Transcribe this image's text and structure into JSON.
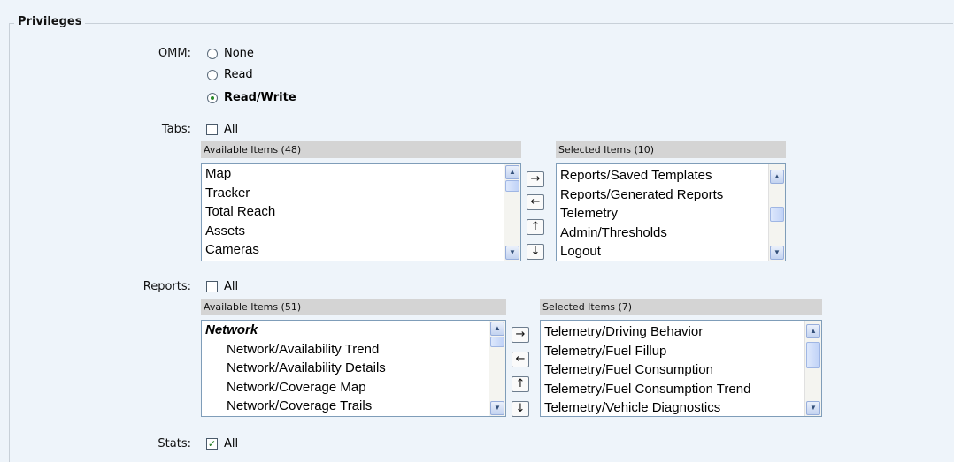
{
  "section": {
    "title": "Privileges"
  },
  "omm": {
    "label": "OMM:",
    "options": [
      {
        "label": "None",
        "selected": false
      },
      {
        "label": "Read",
        "selected": false
      },
      {
        "label": "Read/Write",
        "selected": true
      }
    ]
  },
  "tabs": {
    "label": "Tabs:",
    "all_label": "All",
    "all_checked": false,
    "available_header": "Available Items (48)",
    "selected_header": "Selected Items (10)",
    "available_items": [
      "Map",
      "Tracker",
      "Total Reach",
      "Assets",
      "Cameras"
    ],
    "selected_items": [
      "Reports/Saved Templates",
      "Reports/Generated Reports",
      "Telemetry",
      "Admin/Thresholds",
      "Logout"
    ]
  },
  "reports": {
    "label": "Reports:",
    "all_label": "All",
    "all_checked": false,
    "available_header": "Available Items (51)",
    "selected_header": "Selected Items (7)",
    "available_items": [
      "Network",
      "Network/Availability Trend",
      "Network/Availability Details",
      "Network/Coverage Map",
      "Network/Coverage Trails"
    ],
    "selected_items": [
      "Telemetry/Driving Behavior",
      "Telemetry/Fuel Fillup",
      "Telemetry/Fuel Consumption",
      "Telemetry/Fuel Consumption Trend",
      "Telemetry/Vehicle Diagnostics"
    ]
  },
  "stats": {
    "label": "Stats:",
    "all_label": "All",
    "all_checked": true
  },
  "move_buttons": {
    "right": "→",
    "left": "←",
    "up": "↑",
    "down": "↓"
  },
  "scroll_glyphs": {
    "up": "▲",
    "down": "▼"
  },
  "check_glyph": "✓",
  "icons": [
    "radio-icon",
    "checkbox-icon",
    "arrow-right-icon",
    "arrow-left-icon",
    "arrow-up-icon",
    "arrow-down-icon",
    "scroll-up-icon",
    "scroll-down-icon"
  ]
}
